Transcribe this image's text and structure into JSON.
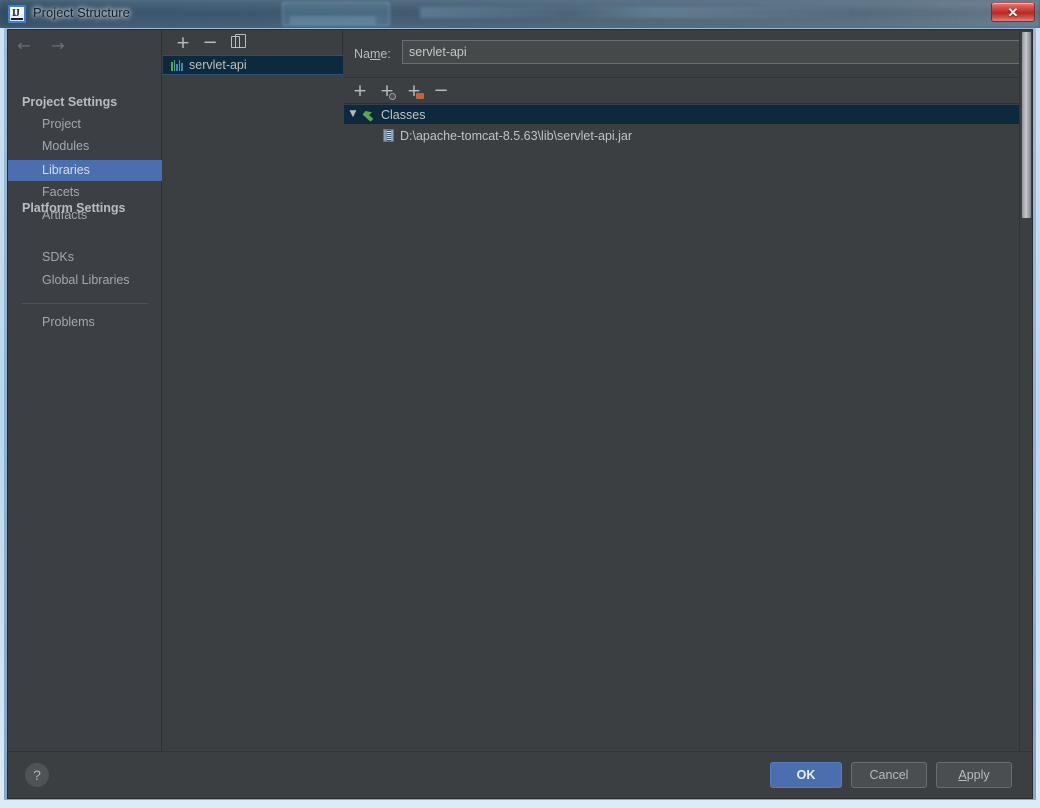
{
  "window": {
    "title": "Project Structure",
    "app_icon": "intellij-idea-icon",
    "close_label": "✕"
  },
  "sidebar": {
    "nav": {
      "back_icon": "←",
      "forward_icon": "→"
    },
    "groups": [
      {
        "label": "Project Settings"
      },
      {
        "label": "Platform Settings"
      }
    ],
    "project_settings_items": [
      {
        "label": "Project",
        "selected": false
      },
      {
        "label": "Modules",
        "selected": false
      },
      {
        "label": "Libraries",
        "selected": true
      },
      {
        "label": "Facets",
        "selected": false
      },
      {
        "label": "Artifacts",
        "selected": false
      }
    ],
    "platform_settings_items": [
      {
        "label": "SDKs",
        "selected": false
      },
      {
        "label": "Global Libraries",
        "selected": false
      }
    ],
    "other_items": [
      {
        "label": "Problems",
        "selected": false
      }
    ]
  },
  "libraries_panel": {
    "toolbar": [
      {
        "name": "add-library-button",
        "icon": "plus-icon",
        "label": "+"
      },
      {
        "name": "remove-library-button",
        "icon": "minus-icon",
        "label": "−"
      },
      {
        "name": "copy-library-button",
        "icon": "copy-icon",
        "label": ""
      }
    ],
    "items": [
      {
        "label": "servlet-api",
        "icon": "library-icon",
        "selected": true
      }
    ]
  },
  "detail": {
    "name_label_pre": "Na",
    "name_label_mnemonic": "m",
    "name_label_post": "e:",
    "name_value": "servlet-api",
    "name_placeholder": "",
    "roots_toolbar": [
      {
        "name": "add-root-button",
        "icon": "plus-icon",
        "label": "+"
      },
      {
        "name": "add-url-root-button",
        "icon": "plus-circle-icon",
        "label": "+"
      },
      {
        "name": "add-jar-directory-button",
        "icon": "plus-folder-icon",
        "label": "+"
      },
      {
        "name": "remove-root-button",
        "icon": "minus-icon",
        "label": "−"
      }
    ],
    "tree": {
      "toggle_icon": "▼",
      "root_label": "Classes",
      "root_icon": "classes-arrow-icon",
      "children": [
        {
          "label": "D:\\apache-tomcat-8.5.63\\lib\\servlet-api.jar",
          "icon": "jar-file-icon"
        }
      ]
    }
  },
  "footer": {
    "help_label": "?",
    "ok_label": "OK",
    "cancel_label": "Cancel",
    "apply_label_pre": "",
    "apply_label_mnemonic": "A",
    "apply_label_post": "pply"
  },
  "colors": {
    "accent_blue": "#4b6eaf",
    "panel_bg": "#3c3f41",
    "sidebar_bg": "#3c4044",
    "selection_tree": "#0d293e",
    "text_primary": "#bfc3c7",
    "close_red": "#b52a25"
  }
}
